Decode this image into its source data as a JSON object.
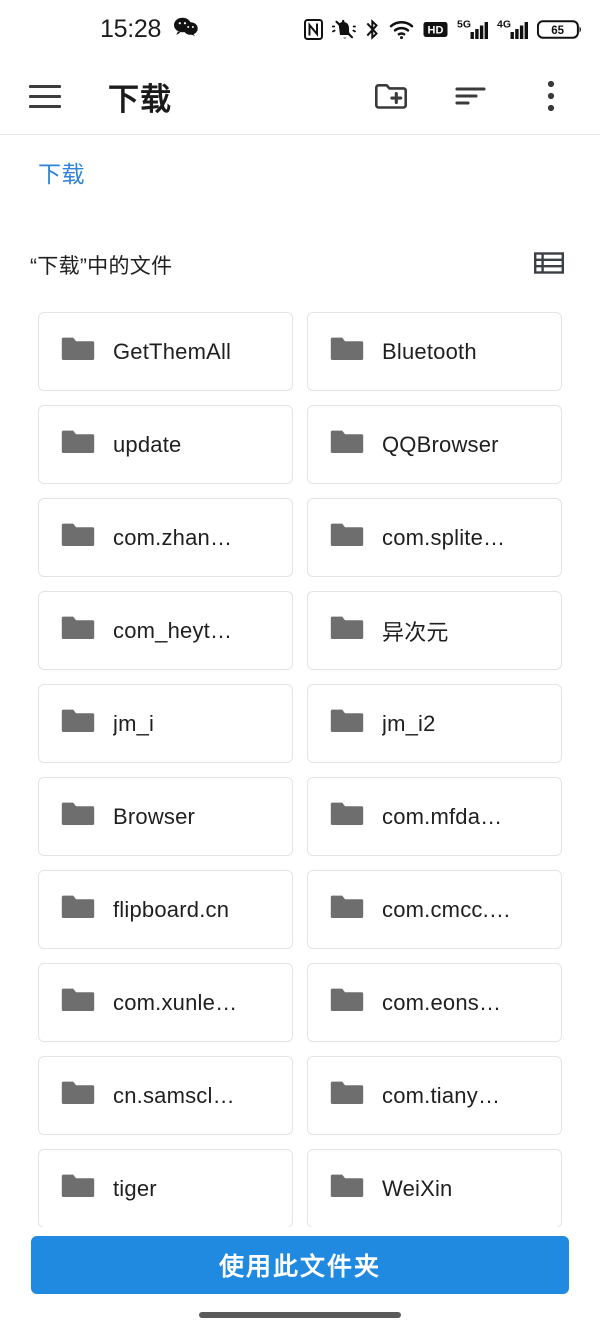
{
  "status_bar": {
    "time": "15:28",
    "notification_icon": "wechat-icon",
    "icons": [
      "nfc-icon",
      "mute-bell-icon",
      "bluetooth-icon",
      "wifi-icon",
      "hd-voice-icon",
      "signal-5g-icon",
      "signal-4g-icon",
      "battery-icon"
    ],
    "battery_level": "65"
  },
  "app_bar": {
    "menu_icon": "hamburger-icon",
    "title": "下载",
    "actions": [
      {
        "name": "new-folder-button",
        "icon": "new-folder-icon"
      },
      {
        "name": "sort-button",
        "icon": "sort-icon"
      },
      {
        "name": "overflow-menu-button",
        "icon": "more-vertical-icon"
      }
    ]
  },
  "breadcrumb": {
    "items": [
      {
        "label": "下载"
      }
    ]
  },
  "section": {
    "title": "“下载”中的文件",
    "view_toggle_icon": "list-view-icon"
  },
  "folders": [
    {
      "name": "GetThemAll"
    },
    {
      "name": "Bluetooth"
    },
    {
      "name": "update"
    },
    {
      "name": "QQBrowser"
    },
    {
      "name": "com.zhan…"
    },
    {
      "name": "com.splite…"
    },
    {
      "name": "com_heyt…"
    },
    {
      "name": "异次元"
    },
    {
      "name": "jm_i"
    },
    {
      "name": "jm_i2"
    },
    {
      "name": "Browser"
    },
    {
      "name": "com.mfda…"
    },
    {
      "name": "flipboard.cn"
    },
    {
      "name": "com.cmcc.…"
    },
    {
      "name": "com.xunle…"
    },
    {
      "name": "com.eons…"
    },
    {
      "name": "cn.samscl…"
    },
    {
      "name": "com.tiany…"
    },
    {
      "name": "tiger"
    },
    {
      "name": "WeiXin"
    }
  ],
  "bottom_bar": {
    "primary_action_label": "使用此文件夹"
  },
  "colors": {
    "accent": "#2089e0",
    "breadcrumb_link": "#2f84d8",
    "folder_icon": "#6e6e6e",
    "card_border": "#e4e4e4",
    "text_primary": "#1f1f1f"
  }
}
